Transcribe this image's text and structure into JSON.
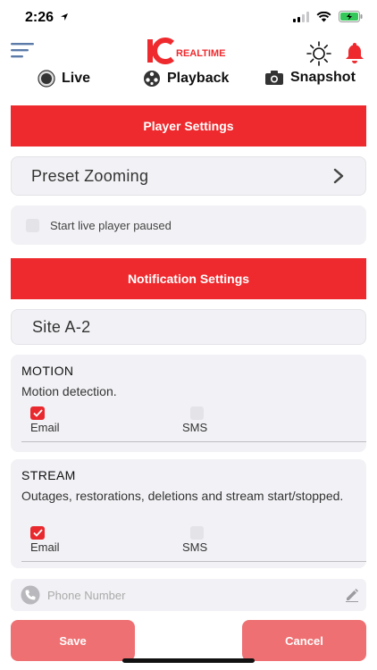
{
  "status_bar": {
    "time": "2:26"
  },
  "header": {
    "logo_ic": "IC",
    "logo_realtime": "REALTIME",
    "menu_icon": "hamburger-icon",
    "brightness_icon": "sun-icon",
    "alerts_icon": "bell-icon"
  },
  "nav": {
    "live": "Live",
    "playback": "Playback",
    "snapshot": "Snapshot"
  },
  "player_settings": {
    "title": "Player Settings",
    "preset_zooming": "Preset Zooming",
    "start_paused_label": "Start live player paused",
    "start_paused_checked": false
  },
  "notification_settings": {
    "title": "Notification Settings",
    "site": "Site A-2",
    "groups": [
      {
        "title": "MOTION",
        "description": "Motion detection.",
        "email_label": "Email",
        "email_checked": true,
        "sms_label": "SMS",
        "sms_checked": false
      },
      {
        "title": "STREAM",
        "description": "Outages, restorations, deletions and stream start/stopped.",
        "email_label": "Email",
        "email_checked": true,
        "sms_label": "SMS",
        "sms_checked": false
      }
    ],
    "phone_placeholder": "Phone Number",
    "phone_value": ""
  },
  "actions": {
    "save": "Save",
    "cancel": "Cancel"
  },
  "colors": {
    "accent_red": "#ee2a2e",
    "button_red": "#ee7072",
    "card_bg": "#f2f2f6"
  }
}
